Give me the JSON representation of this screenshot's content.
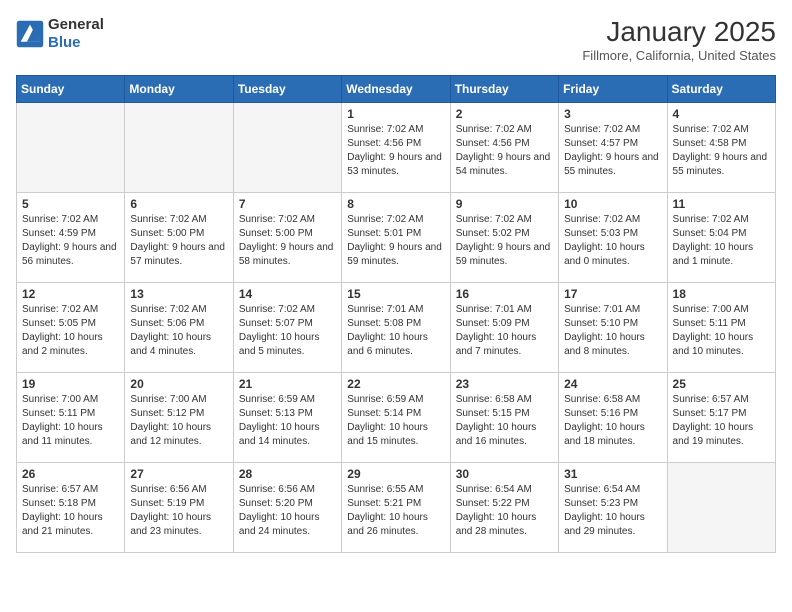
{
  "header": {
    "logo_general": "General",
    "logo_blue": "Blue",
    "month": "January 2025",
    "location": "Fillmore, California, United States"
  },
  "weekdays": [
    "Sunday",
    "Monday",
    "Tuesday",
    "Wednesday",
    "Thursday",
    "Friday",
    "Saturday"
  ],
  "weeks": [
    [
      {
        "day": "",
        "info": ""
      },
      {
        "day": "",
        "info": ""
      },
      {
        "day": "",
        "info": ""
      },
      {
        "day": "1",
        "info": "Sunrise: 7:02 AM\nSunset: 4:56 PM\nDaylight: 9 hours and 53 minutes."
      },
      {
        "day": "2",
        "info": "Sunrise: 7:02 AM\nSunset: 4:56 PM\nDaylight: 9 hours and 54 minutes."
      },
      {
        "day": "3",
        "info": "Sunrise: 7:02 AM\nSunset: 4:57 PM\nDaylight: 9 hours and 55 minutes."
      },
      {
        "day": "4",
        "info": "Sunrise: 7:02 AM\nSunset: 4:58 PM\nDaylight: 9 hours and 55 minutes."
      }
    ],
    [
      {
        "day": "5",
        "info": "Sunrise: 7:02 AM\nSunset: 4:59 PM\nDaylight: 9 hours and 56 minutes."
      },
      {
        "day": "6",
        "info": "Sunrise: 7:02 AM\nSunset: 5:00 PM\nDaylight: 9 hours and 57 minutes."
      },
      {
        "day": "7",
        "info": "Sunrise: 7:02 AM\nSunset: 5:00 PM\nDaylight: 9 hours and 58 minutes."
      },
      {
        "day": "8",
        "info": "Sunrise: 7:02 AM\nSunset: 5:01 PM\nDaylight: 9 hours and 59 minutes."
      },
      {
        "day": "9",
        "info": "Sunrise: 7:02 AM\nSunset: 5:02 PM\nDaylight: 9 hours and 59 minutes."
      },
      {
        "day": "10",
        "info": "Sunrise: 7:02 AM\nSunset: 5:03 PM\nDaylight: 10 hours and 0 minutes."
      },
      {
        "day": "11",
        "info": "Sunrise: 7:02 AM\nSunset: 5:04 PM\nDaylight: 10 hours and 1 minute."
      }
    ],
    [
      {
        "day": "12",
        "info": "Sunrise: 7:02 AM\nSunset: 5:05 PM\nDaylight: 10 hours and 2 minutes."
      },
      {
        "day": "13",
        "info": "Sunrise: 7:02 AM\nSunset: 5:06 PM\nDaylight: 10 hours and 4 minutes."
      },
      {
        "day": "14",
        "info": "Sunrise: 7:02 AM\nSunset: 5:07 PM\nDaylight: 10 hours and 5 minutes."
      },
      {
        "day": "15",
        "info": "Sunrise: 7:01 AM\nSunset: 5:08 PM\nDaylight: 10 hours and 6 minutes."
      },
      {
        "day": "16",
        "info": "Sunrise: 7:01 AM\nSunset: 5:09 PM\nDaylight: 10 hours and 7 minutes."
      },
      {
        "day": "17",
        "info": "Sunrise: 7:01 AM\nSunset: 5:10 PM\nDaylight: 10 hours and 8 minutes."
      },
      {
        "day": "18",
        "info": "Sunrise: 7:00 AM\nSunset: 5:11 PM\nDaylight: 10 hours and 10 minutes."
      }
    ],
    [
      {
        "day": "19",
        "info": "Sunrise: 7:00 AM\nSunset: 5:11 PM\nDaylight: 10 hours and 11 minutes."
      },
      {
        "day": "20",
        "info": "Sunrise: 7:00 AM\nSunset: 5:12 PM\nDaylight: 10 hours and 12 minutes."
      },
      {
        "day": "21",
        "info": "Sunrise: 6:59 AM\nSunset: 5:13 PM\nDaylight: 10 hours and 14 minutes."
      },
      {
        "day": "22",
        "info": "Sunrise: 6:59 AM\nSunset: 5:14 PM\nDaylight: 10 hours and 15 minutes."
      },
      {
        "day": "23",
        "info": "Sunrise: 6:58 AM\nSunset: 5:15 PM\nDaylight: 10 hours and 16 minutes."
      },
      {
        "day": "24",
        "info": "Sunrise: 6:58 AM\nSunset: 5:16 PM\nDaylight: 10 hours and 18 minutes."
      },
      {
        "day": "25",
        "info": "Sunrise: 6:57 AM\nSunset: 5:17 PM\nDaylight: 10 hours and 19 minutes."
      }
    ],
    [
      {
        "day": "26",
        "info": "Sunrise: 6:57 AM\nSunset: 5:18 PM\nDaylight: 10 hours and 21 minutes."
      },
      {
        "day": "27",
        "info": "Sunrise: 6:56 AM\nSunset: 5:19 PM\nDaylight: 10 hours and 23 minutes."
      },
      {
        "day": "28",
        "info": "Sunrise: 6:56 AM\nSunset: 5:20 PM\nDaylight: 10 hours and 24 minutes."
      },
      {
        "day": "29",
        "info": "Sunrise: 6:55 AM\nSunset: 5:21 PM\nDaylight: 10 hours and 26 minutes."
      },
      {
        "day": "30",
        "info": "Sunrise: 6:54 AM\nSunset: 5:22 PM\nDaylight: 10 hours and 28 minutes."
      },
      {
        "day": "31",
        "info": "Sunrise: 6:54 AM\nSunset: 5:23 PM\nDaylight: 10 hours and 29 minutes."
      },
      {
        "day": "",
        "info": ""
      }
    ]
  ]
}
